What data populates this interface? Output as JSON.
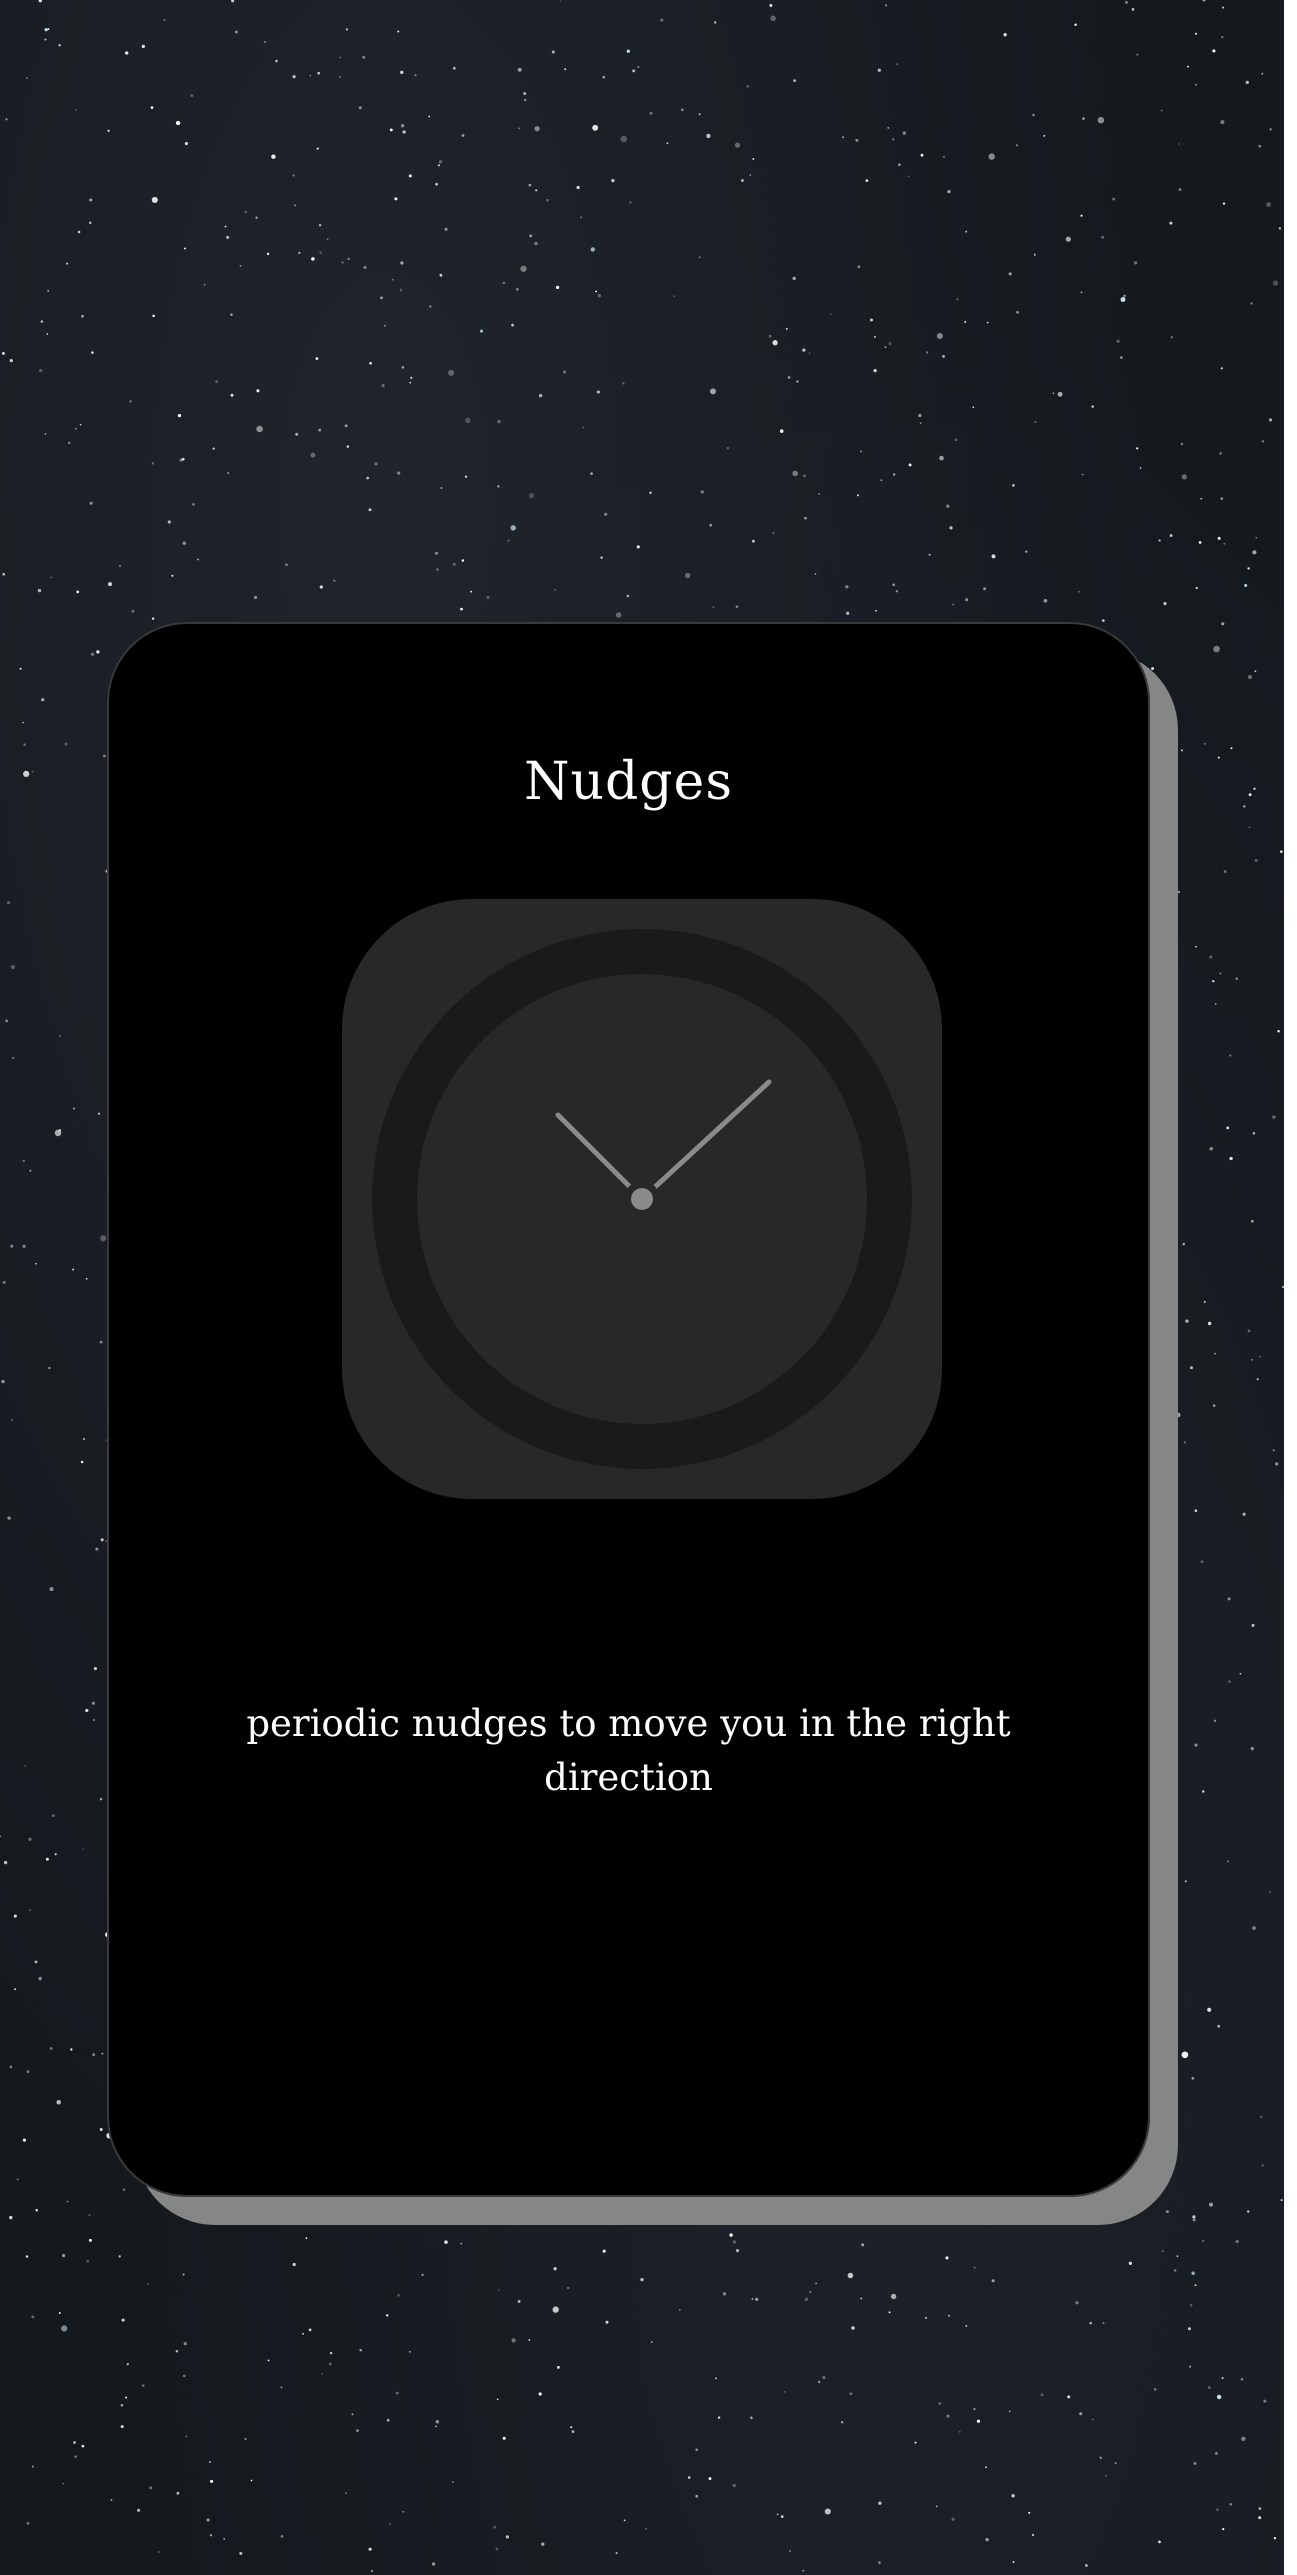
{
  "card": {
    "title": "Nudges",
    "description": "periodic nudges to move you in the right direction",
    "icon": "clock-icon"
  },
  "colors": {
    "background": "#14191e",
    "card": "#000000",
    "card_shadow": "#858787",
    "icon_tile": "#282828",
    "clock_hands": "#8a8a8a",
    "text": "#ffffff"
  }
}
